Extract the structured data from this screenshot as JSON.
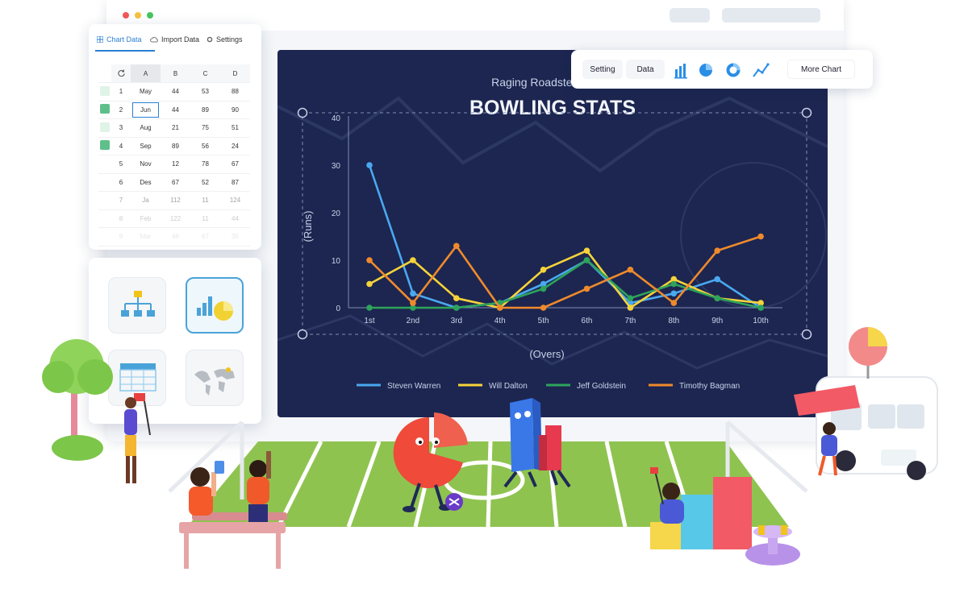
{
  "window": {
    "dots": [
      "#f2575a",
      "#f5c142",
      "#45c660"
    ]
  },
  "data_panel": {
    "tabs": [
      {
        "label": "Chart Data",
        "active": true
      },
      {
        "label": "Import Data",
        "active": false
      },
      {
        "label": "Settings",
        "active": false
      }
    ],
    "columns": [
      "A",
      "B",
      "C",
      "D"
    ],
    "rows": [
      {
        "n": "1",
        "a": "May",
        "b": "44",
        "c": "53",
        "d": "88",
        "check": "light"
      },
      {
        "n": "2",
        "a": "Jun",
        "b": "44",
        "c": "89",
        "d": "90",
        "check": "dark"
      },
      {
        "n": "3",
        "a": "Aug",
        "b": "21",
        "c": "75",
        "d": "51",
        "check": "light"
      },
      {
        "n": "4",
        "a": "Sep",
        "b": "89",
        "c": "56",
        "d": "24",
        "check": "dark"
      },
      {
        "n": "5",
        "a": "Nov",
        "b": "12",
        "c": "78",
        "d": "67",
        "check": "none"
      },
      {
        "n": "6",
        "a": "Des",
        "b": "67",
        "c": "52",
        "d": "87",
        "check": "none"
      },
      {
        "n": "7",
        "a": "Ja",
        "b": "112",
        "c": "11",
        "d": "124",
        "check": "none"
      },
      {
        "n": "8",
        "a": "Feb",
        "b": "122",
        "c": "11",
        "d": "44",
        "check": "none"
      },
      {
        "n": "9",
        "a": "Mar",
        "b": "46",
        "c": "67",
        "d": "35",
        "check": "none"
      }
    ]
  },
  "toolbar": {
    "setting_label": "Setting",
    "data_label": "Data",
    "more_label": "More Chart",
    "icons": [
      "bar-chart-icon",
      "pie-chart-icon",
      "donut-chart-icon",
      "line-chart-icon"
    ],
    "accent": "#2a8ee6"
  },
  "chart_data": {
    "type": "line",
    "subtitle": "Raging Roadsters vs Ch",
    "title": "BOWLING STATS",
    "xlabel": "(Overs)",
    "ylabel": "(Runs)",
    "ylim": [
      0,
      40
    ],
    "yticks": [
      0,
      10,
      20,
      30,
      40
    ],
    "categories": [
      "1st",
      "2nd",
      "3rd",
      "4th",
      "5th",
      "6th",
      "7th",
      "8th",
      "9th",
      "10th"
    ],
    "series": [
      {
        "name": "Steven Warren",
        "color": "#4aa8f0",
        "values": [
          30,
          3,
          0,
          1,
          5,
          10,
          1,
          3,
          6,
          0
        ]
      },
      {
        "name": "Will Dalton",
        "color": "#f6d33a",
        "values": [
          5,
          10,
          2,
          0,
          8,
          12,
          0,
          6,
          2,
          1
        ]
      },
      {
        "name": "Jeff Goldstein",
        "color": "#2ea35a",
        "values": [
          0,
          0,
          0,
          1,
          4,
          10,
          2,
          5,
          2,
          0
        ]
      },
      {
        "name": "Timothy Bagman",
        "color": "#ef8a2c",
        "values": [
          10,
          1,
          13,
          0,
          0,
          4,
          8,
          1,
          12,
          15
        ]
      }
    ],
    "legend": "bottom",
    "grid": false
  }
}
